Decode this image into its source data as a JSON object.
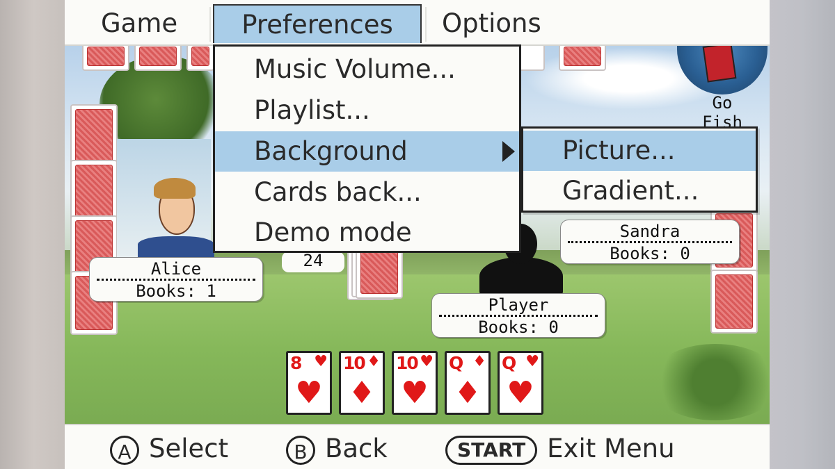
{
  "menubar": {
    "items": [
      "Game",
      "Preferences",
      "Options"
    ],
    "active_item": "Preferences"
  },
  "preferences_menu": {
    "items": [
      "Music Volume...",
      "Playlist...",
      "Background",
      "Cards back...",
      "Demo mode"
    ],
    "highlighted": "Background"
  },
  "background_submenu": {
    "items": [
      "Picture...",
      "Gradient..."
    ],
    "highlighted": "Picture..."
  },
  "players": {
    "alice": {
      "name": "Alice",
      "books": "Books: 1"
    },
    "sandra": {
      "name": "Sandra",
      "books": "Books: 0"
    },
    "player": {
      "name": "Player",
      "books": "Books: 0"
    }
  },
  "deck": {
    "count": "24"
  },
  "logo": {
    "text_line1": "Go",
    "text_line2": "Fish"
  },
  "hand": [
    {
      "rank": "8",
      "suit": "♥"
    },
    {
      "rank": "10",
      "suit": "♦"
    },
    {
      "rank": "10",
      "suit": "♥"
    },
    {
      "rank": "Q",
      "suit": "♦"
    },
    {
      "rank": "Q",
      "suit": "♥"
    }
  ],
  "bottombar": {
    "a_button": "A",
    "a_label": "Select",
    "b_button": "B",
    "b_label": "Back",
    "start_button": "START",
    "start_label": "Exit Menu"
  },
  "colors": {
    "highlight": "#a9cde8",
    "card_red": "#e01818",
    "bezel": "#cfc8c4"
  }
}
